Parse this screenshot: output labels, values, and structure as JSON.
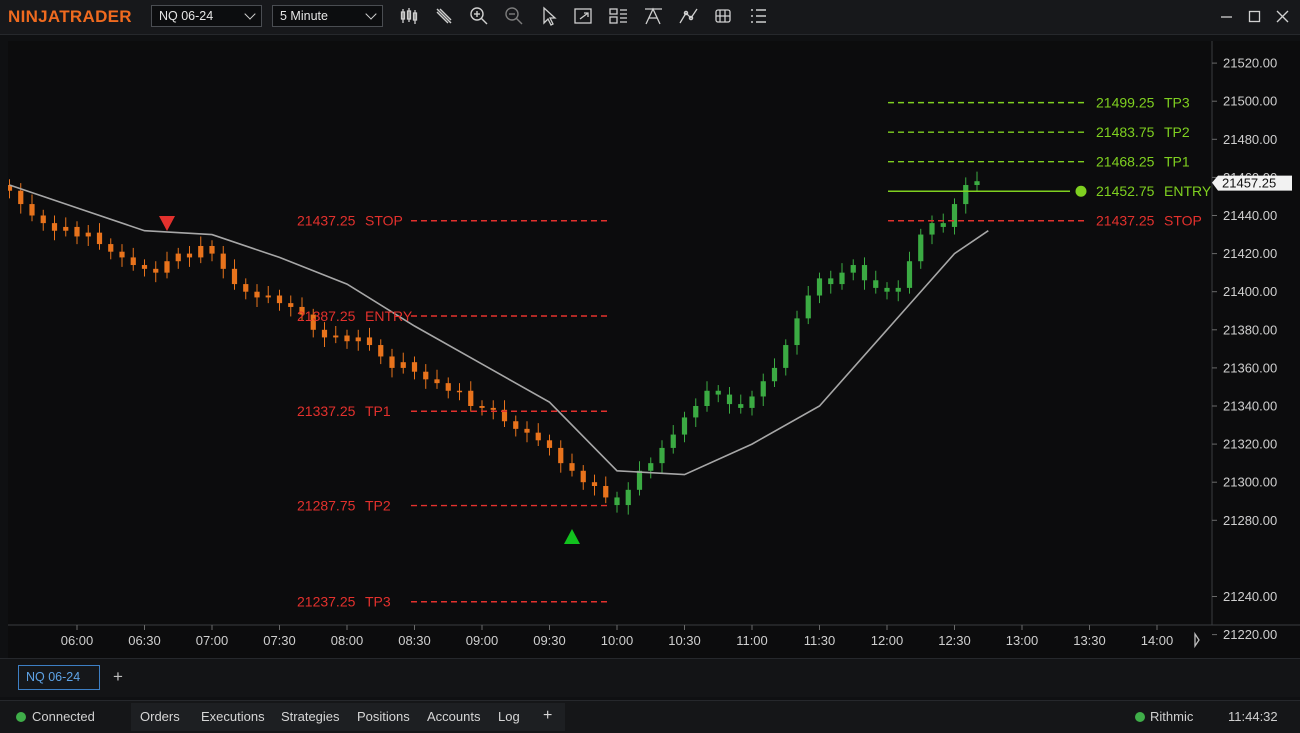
{
  "app": {
    "logo": "NINJATRADER"
  },
  "toolbar": {
    "instrument": "NQ 06-24",
    "interval": "5 Minute",
    "tools": [
      "bar-type-icon",
      "pencil-icon",
      "zoom-in-icon",
      "zoom-out-icon",
      "pointer-icon",
      "export-icon",
      "chart-properties-icon",
      "drawing-tools-icon",
      "indicators-icon",
      "strategies-icon",
      "data-box-icon"
    ]
  },
  "chart_data": {
    "type": "candlestick",
    "instrument": "NQ 06-24",
    "interval": "5 Minute",
    "y_ticks": [
      "21520.00",
      "21500.00",
      "21480.00",
      "21460.00",
      "21440.00",
      "21420.00",
      "21400.00",
      "21380.00",
      "21360.00",
      "21340.00",
      "21320.00",
      "21300.00",
      "21280.00",
      "21240.00",
      "21220.00"
    ],
    "x_ticks": [
      "06:00",
      "06:30",
      "07:00",
      "07:30",
      "08:00",
      "08:30",
      "09:00",
      "09:30",
      "10:00",
      "10:30",
      "11:00",
      "11:30",
      "12:00",
      "12:30",
      "13:00",
      "13:30",
      "14:00"
    ],
    "last_price": "21457.25",
    "short_trade": {
      "signal_time": "06:40",
      "levels": [
        {
          "label": "STOP",
          "price": "21437.25"
        },
        {
          "label": "ENTRY",
          "price": "21387.25"
        },
        {
          "label": "TP1",
          "price": "21337.25"
        },
        {
          "label": "TP2",
          "price": "21287.75"
        },
        {
          "label": "TP3",
          "price": "21237.25"
        }
      ],
      "color": "#e3312d"
    },
    "long_trade": {
      "signal_time": "09:40",
      "levels": [
        {
          "label": "TP3",
          "price": "21499.25"
        },
        {
          "label": "TP2",
          "price": "21483.75"
        },
        {
          "label": "TP1",
          "price": "21468.25"
        },
        {
          "label": "ENTRY",
          "price": "21452.75"
        },
        {
          "label": "STOP",
          "price": "21437.25"
        }
      ],
      "color": "#7fd020"
    },
    "colors": {
      "down": "#e8731c",
      "up": "#3bab43",
      "ma": "#a7a7a7",
      "background": "#0c0c0d"
    }
  },
  "tabs": {
    "active": "NQ 06-24",
    "add": "+"
  },
  "status": {
    "connection": "Connected",
    "tabs": [
      "Orders",
      "Executions",
      "Strategies",
      "Positions",
      "Accounts",
      "Log"
    ],
    "add": "+",
    "provider": "Rithmic",
    "time": "11:44:32"
  }
}
